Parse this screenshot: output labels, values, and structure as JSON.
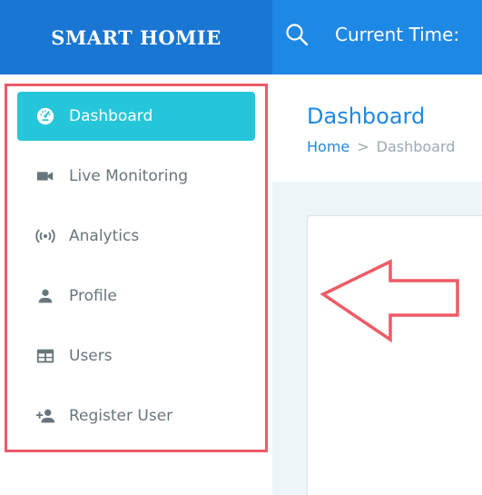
{
  "brand": {
    "name": "SMART HOMIE"
  },
  "topbar": {
    "time_label": "Current Time:"
  },
  "sidebar": {
    "items": [
      {
        "label": "Dashboard",
        "icon": "speedometer-icon",
        "active": true
      },
      {
        "label": "Live Monitoring",
        "icon": "videocam-icon",
        "active": false
      },
      {
        "label": "Analytics",
        "icon": "broadcast-icon",
        "active": false
      },
      {
        "label": "Profile",
        "icon": "person-icon",
        "active": false
      },
      {
        "label": "Users",
        "icon": "table-icon",
        "active": false
      },
      {
        "label": "Register User",
        "icon": "person-add-icon",
        "active": false
      }
    ]
  },
  "main": {
    "title": "Dashboard",
    "breadcrumb": {
      "home": "Home",
      "separator": ">",
      "current": "Dashboard"
    }
  },
  "colors": {
    "brand_bg": "#1976d2",
    "topbar_bg": "#1e88e5",
    "active_item": "#26c6da",
    "highlight": "#ed5a66",
    "muted_text": "#67757c"
  }
}
